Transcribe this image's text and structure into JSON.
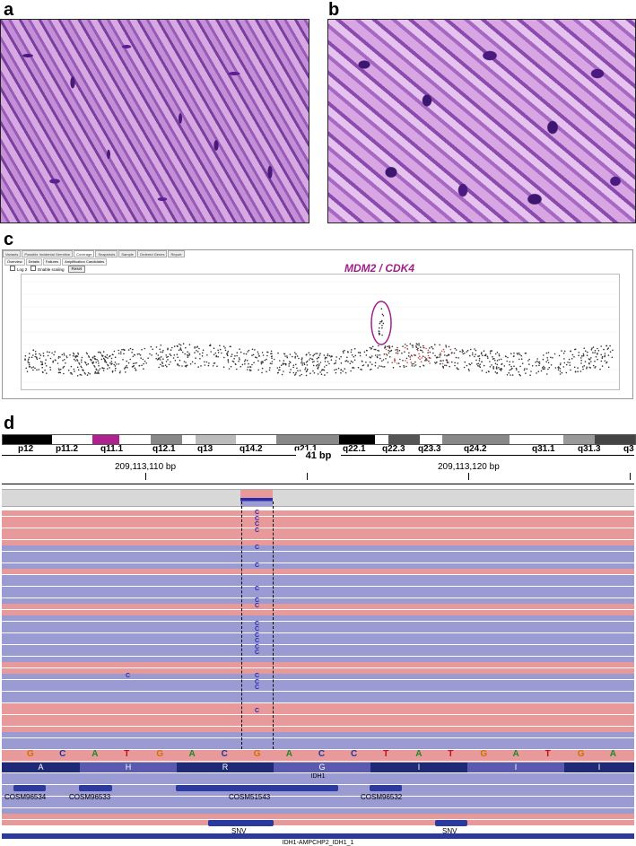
{
  "panels": {
    "a": "a",
    "b": "b",
    "c": "c",
    "d": "d"
  },
  "panel_c": {
    "tabs": [
      "Variants",
      "Possible Incidental Germline",
      "Coverage",
      "Snapshots",
      "Sample",
      "Ordered Genes",
      "Report"
    ],
    "subtabs": [
      "Overview",
      "Details",
      "Failures",
      "Amplification Candidates"
    ],
    "opt_log": "Log 2",
    "opt_scale": "Enable scaling",
    "reset": "Reset",
    "annotation": "MDM2 / CDK4",
    "colors": {
      "points": "#333333",
      "highlight": "#a0208a",
      "red_points": "#d04040"
    }
  },
  "panel_d": {
    "bands": [
      "p12",
      "p11.2",
      "q11.1",
      "q12.1",
      "q13",
      "q14.2",
      "q21.1",
      "q22.1",
      "q22.3",
      "q23.3",
      "q24.2",
      "q31.1",
      "q31.3",
      "q3"
    ],
    "span": "41 bp",
    "ruler": [
      "209,113,110 bp",
      "209,113,120 bp"
    ],
    "sequence": [
      "G",
      "C",
      "A",
      "T",
      "G",
      "A",
      "C",
      "G",
      "A",
      "C",
      "C",
      "T",
      "A",
      "T",
      "G",
      "A",
      "T",
      "G",
      "A"
    ],
    "amino_acids": [
      "A",
      "H",
      "R",
      "G",
      "I",
      "I",
      "I"
    ],
    "gene": "IDH1",
    "cosmic": [
      "COSM96534",
      "COSM96533",
      "COSM51543",
      "COSM96532"
    ],
    "snv": [
      "SNV",
      "SNV"
    ],
    "transcript": "IDH1-AMPCHP2_IDH1_1",
    "mismatch": "C",
    "colors": {
      "read_pos": "#e8999a",
      "read_neg": "#9b9bd3",
      "feature": "#2a3aa0",
      "mismatch": "#2a2ab0"
    }
  }
}
